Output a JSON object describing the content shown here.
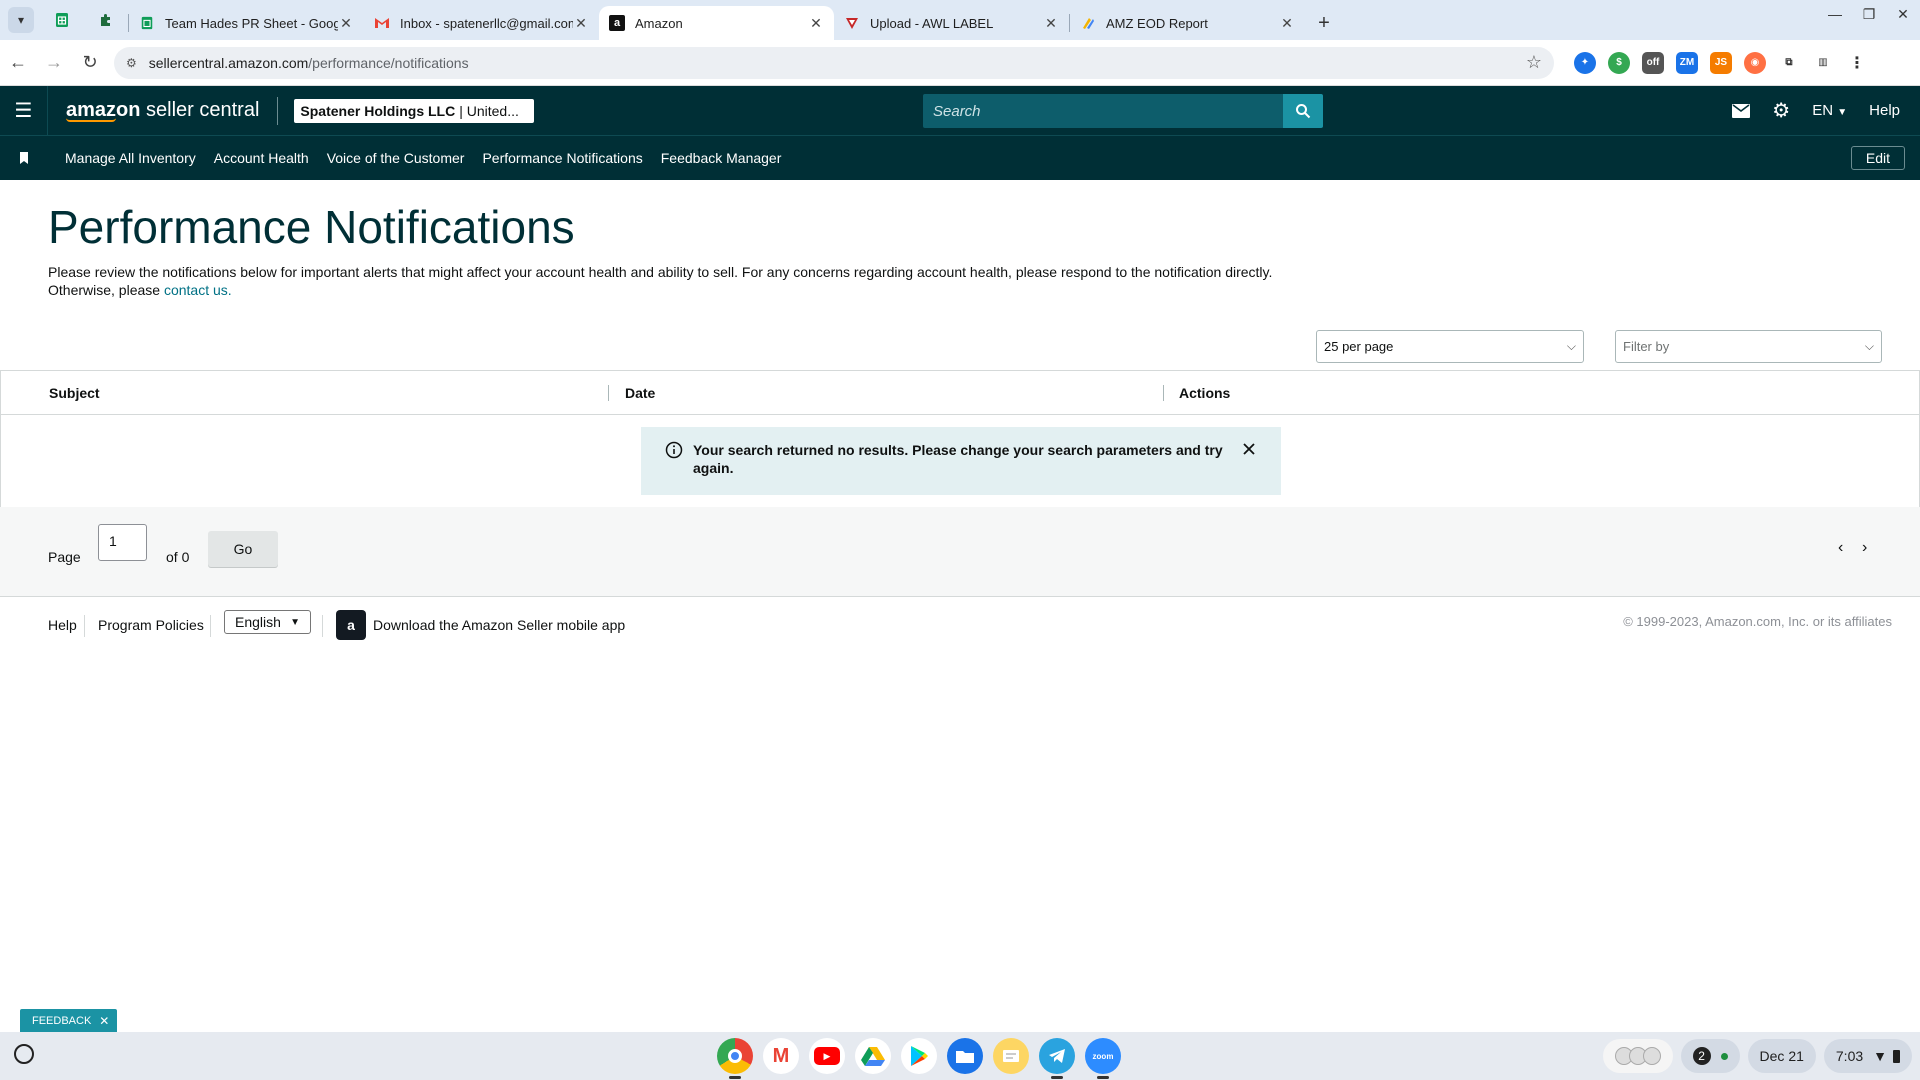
{
  "browser": {
    "tabs": [
      {
        "title": "",
        "favicon": "sheets-icon",
        "pinned": true
      },
      {
        "title": "",
        "favicon": "puzzle-icon",
        "pinned": true
      },
      {
        "title": "Team Hades PR Sheet - Google",
        "favicon": "sheets-icon"
      },
      {
        "title": "Inbox - spatenerllc@gmail.com",
        "favicon": "gmail-icon"
      },
      {
        "title": "Amazon",
        "favicon": "amazon-icon",
        "active": true
      },
      {
        "title": "Upload - AWL LABEL",
        "favicon": "awl-icon"
      },
      {
        "title": "AMZ EOD Report",
        "favicon": "eod-icon"
      }
    ],
    "url_host": "sellercentral.amazon.com",
    "url_path": "/performance/notifications"
  },
  "header": {
    "logo_text_bold": "amazon",
    "logo_text": "seller central",
    "account_name": "Spatener Holdings LLC",
    "account_region": "| United...",
    "search_placeholder": "Search",
    "language": "EN",
    "help": "Help"
  },
  "nav": {
    "links": [
      "Manage All Inventory",
      "Account Health",
      "Voice of the Customer",
      "Performance Notifications",
      "Feedback Manager"
    ],
    "edit": "Edit"
  },
  "main": {
    "title": "Performance Notifications",
    "intro_text": "Please review the notifications below for important alerts that might affect your account health and ability to sell. For any concerns regarding account health, please respond to the notification directly. Otherwise, please ",
    "contact_link": "contact us.",
    "per_page": "25 per page",
    "filter_placeholder": "Filter by",
    "table": {
      "columns": [
        "Subject",
        "Date",
        "Actions"
      ],
      "empty_message": "Your search returned no results. Please change your search parameters and try again."
    },
    "pager": {
      "page_label": "Page",
      "page_value": "1",
      "of_label": "of 0",
      "go": "Go"
    }
  },
  "footer": {
    "help": "Help",
    "policies": "Program Policies",
    "language": "English",
    "app_link": "Download the Amazon Seller mobile app",
    "copyright": "© 1999-2023, Amazon.com, Inc. or its affiliates"
  },
  "feedback": "FEEDBACK",
  "shelf": {
    "notifications": "2",
    "date": "Dec 21",
    "time": "7:03"
  },
  "colors": {
    "header_bg": "#002f36",
    "accent": "#1b93a4",
    "link": "#007185"
  }
}
